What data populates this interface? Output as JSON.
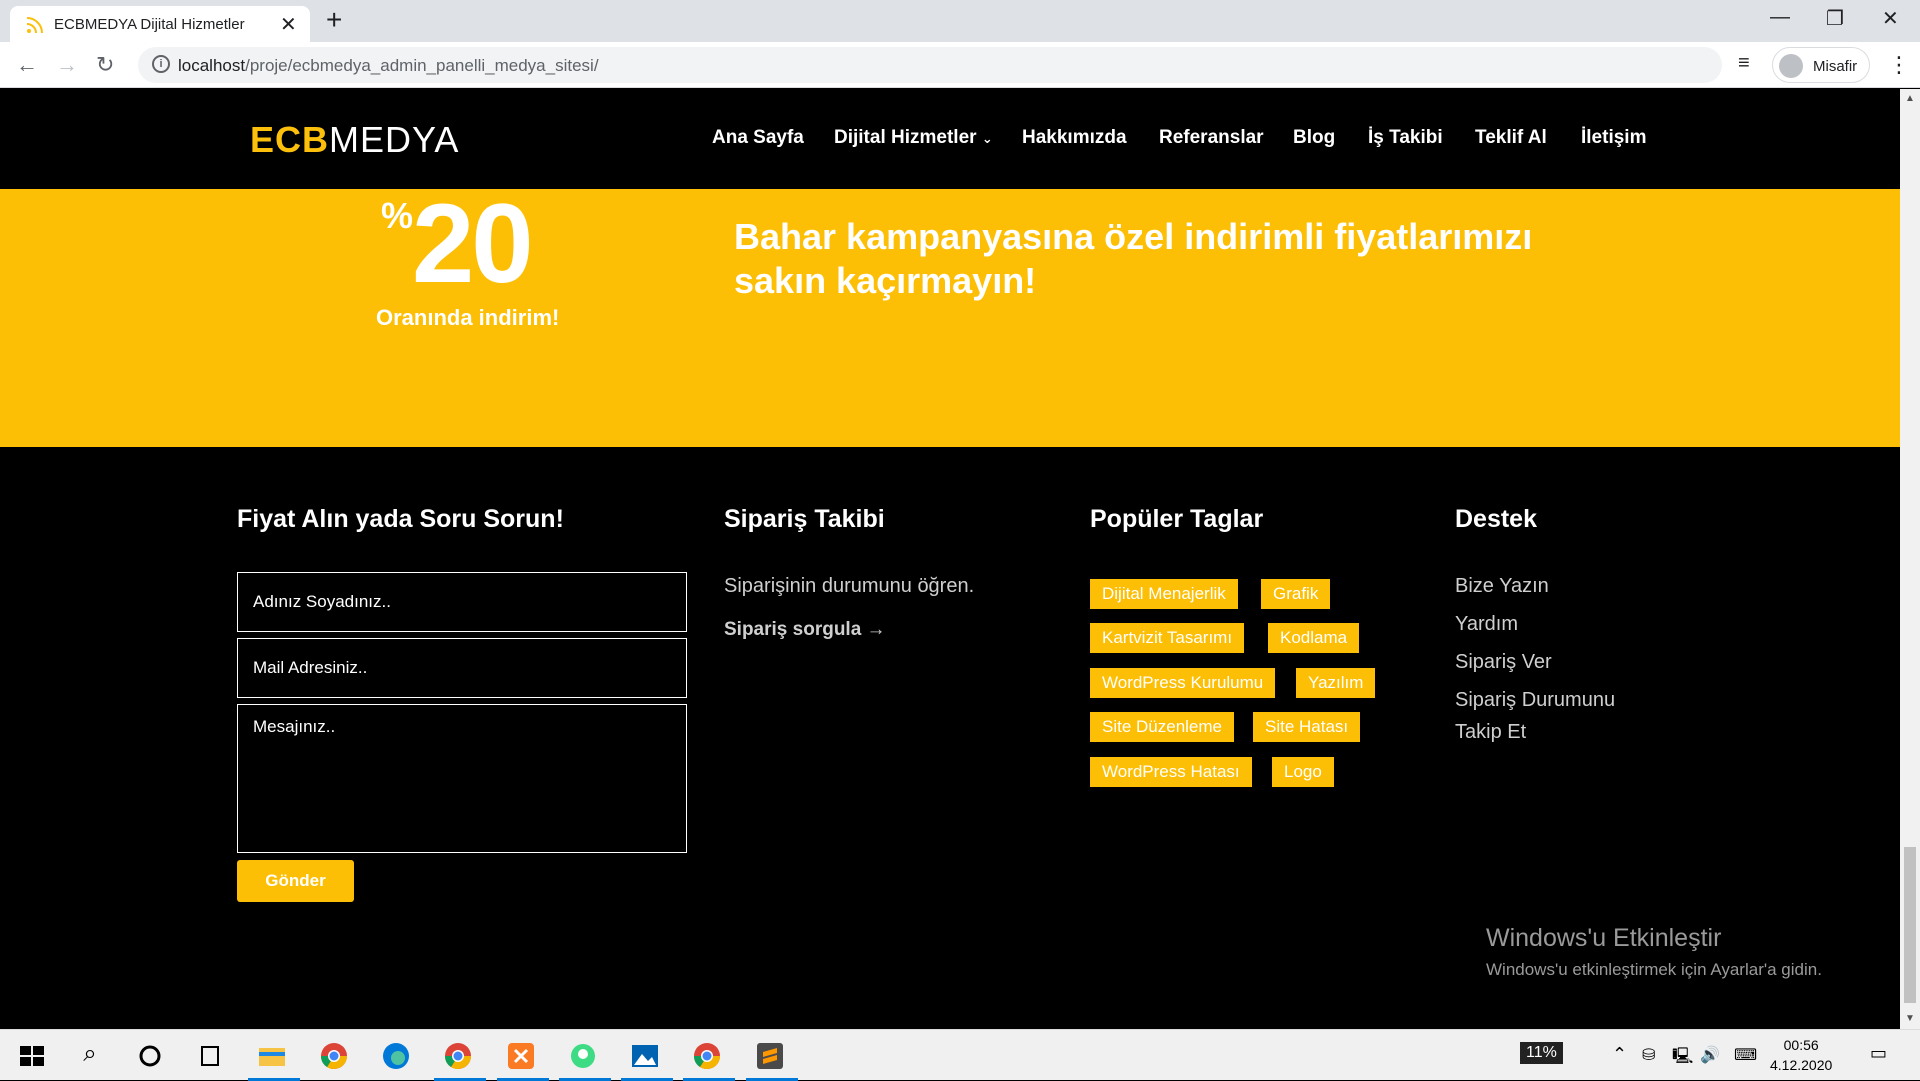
{
  "browser": {
    "tab_title": "ECBMEDYA Dijital Hizmetler",
    "url_host": "localhost",
    "url_path": "/proje/ecbmedya_admin_panelli_medya_sitesi/",
    "profile_name": "Misafir",
    "icons": [
      "rss-icon",
      "close-icon",
      "plus-icon",
      "back-icon",
      "forward-icon",
      "reload-icon",
      "info-icon",
      "media-icon",
      "avatar-icon",
      "kebab-menu-icon"
    ]
  },
  "site": {
    "logo_ecb": "ECB",
    "logo_medya": "MEDYA",
    "nav": [
      "Ana Sayfa",
      "Dijital Hizmetler",
      "Hakkımızda",
      "Referanslar",
      "Blog",
      "İş Takibi",
      "Teklif Al",
      "İletişim"
    ]
  },
  "promo": {
    "percent_sign": "%",
    "number": "20",
    "subtitle": "Oranında indirim!",
    "text": "Bahar kampanyasına özel indirimli fiyatlarımızı sakın kaçırmayın!"
  },
  "footer": {
    "form": {
      "heading": "Fiyat Alın yada Soru Sorun!",
      "name_placeholder": "Adınız Soyadınız..",
      "mail_placeholder": "Mail Adresiniz..",
      "message_placeholder": "Mesajınız..",
      "submit": "Gönder"
    },
    "order": {
      "heading": "Sipariş Takibi",
      "text": "Siparişinin durumunu öğren.",
      "link": "Sipariş sorgula →"
    },
    "tags": {
      "heading": "Popüler Taglar",
      "items": [
        "Dijital Menajerlik",
        "Grafik",
        "Kartvizit Tasarımı",
        "Kodlama",
        "WordPress Kurulumu",
        "Yazılım",
        "Site Düzenleme",
        "Site Hatası",
        "WordPress Hatası",
        "Logo"
      ]
    },
    "support": {
      "heading": "Destek",
      "links": [
        "Bize Yazın",
        "Yardım",
        "Sipariş Ver",
        "Sipariş Durumunu Takip Et"
      ]
    }
  },
  "windows": {
    "activate_title": "Windows'u Etkinleştir",
    "activate_text": "Windows'u etkinleştirmek için Ayarlar'a gidin.",
    "time": "00:56",
    "date": "4.12.2020",
    "battery": "11%"
  },
  "colors": {
    "accent": "#fcbf05",
    "background": "#000000"
  }
}
